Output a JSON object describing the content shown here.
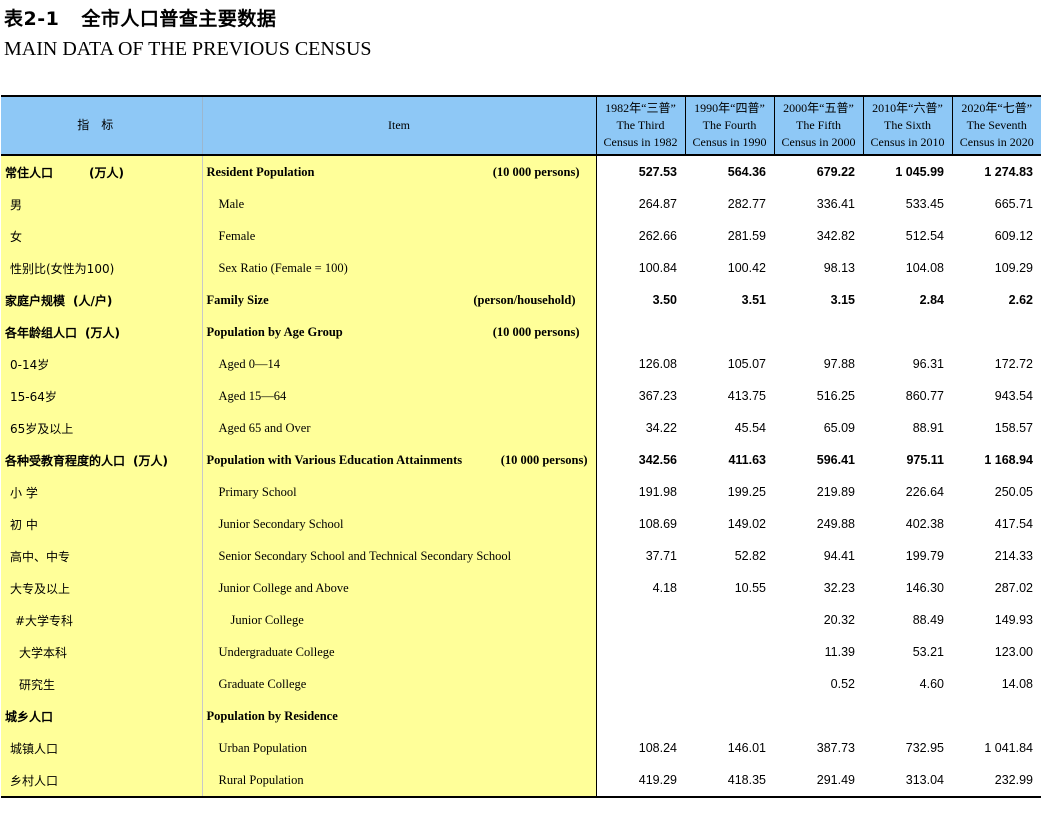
{
  "title": {
    "number": "表2-1",
    "cn": "全市人口普查主要数据",
    "en": "MAIN DATA OF THE PREVIOUS CENSUS"
  },
  "header": {
    "indicator": "指标",
    "item": "Item",
    "censuses": [
      {
        "cn": "1982年“三普”",
        "en1": "The Third",
        "en2": "Census in 1982"
      },
      {
        "cn": "1990年“四普”",
        "en1": "The Fourth",
        "en2": "Census in 1990"
      },
      {
        "cn": "2000年“五普”",
        "en1": "The Fifth",
        "en2": "Census in 2000"
      },
      {
        "cn": "2010年“六普”",
        "en1": "The Sixth",
        "en2": "Census in 2010"
      },
      {
        "cn": "2020年“七普”",
        "en1": "The Seventh",
        "en2": "Census in 2020"
      }
    ]
  },
  "rows": [
    {
      "name": "常住人口",
      "unit": "(万人)",
      "item": "Resident Population",
      "item_unit": "(10 000 persons)",
      "values": [
        "527.53",
        "564.36",
        "679.22",
        "1 045.99",
        "1 274.83"
      ],
      "bold": true,
      "level": 0
    },
    {
      "name": "男",
      "unit": "",
      "item": "Male",
      "item_unit": "",
      "values": [
        "264.87",
        "282.77",
        "336.41",
        "533.45",
        "665.71"
      ],
      "bold": false,
      "level": 1
    },
    {
      "name": "女",
      "unit": "",
      "item": "Female",
      "item_unit": "",
      "values": [
        "262.66",
        "281.59",
        "342.82",
        "512.54",
        "609.12"
      ],
      "bold": false,
      "level": 1
    },
    {
      "name": "性别比(女性为100)",
      "unit": "",
      "item": "Sex Ratio  (Female = 100)",
      "item_unit": "",
      "values": [
        "100.84",
        "100.42",
        "98.13",
        "104.08",
        "109.29"
      ],
      "bold": false,
      "level": 1
    },
    {
      "name": "家庭户规模",
      "unit": "(人/户)",
      "item": "Family Size",
      "item_unit": "(person/household)",
      "values": [
        "3.50",
        "3.51",
        "3.15",
        "2.84",
        "2.62"
      ],
      "bold": true,
      "level": 0
    },
    {
      "name": "各年龄组人口",
      "unit": "(万人)",
      "item": "Population by Age Group",
      "item_unit": "(10 000 persons)",
      "values": [
        "",
        "",
        "",
        "",
        ""
      ],
      "bold": true,
      "level": 0
    },
    {
      "name": "0-14岁",
      "unit": "",
      "item": "Aged 0—14",
      "item_unit": "",
      "values": [
        "126.08",
        "105.07",
        "97.88",
        "96.31",
        "172.72"
      ],
      "bold": false,
      "level": 1
    },
    {
      "name": "15-64岁",
      "unit": "",
      "item": "Aged 15—64",
      "item_unit": "",
      "values": [
        "367.23",
        "413.75",
        "516.25",
        "860.77",
        "943.54"
      ],
      "bold": false,
      "level": 1
    },
    {
      "name": "65岁及以上",
      "unit": "",
      "item": "Aged 65 and Over",
      "item_unit": "",
      "values": [
        "34.22",
        "45.54",
        "65.09",
        "88.91",
        "158.57"
      ],
      "bold": false,
      "level": 1
    },
    {
      "name": "各种受教育程度的人口",
      "unit": "(万人)",
      "item": "Population with Various Education Attainments",
      "item_unit": "(10 000 persons)",
      "values": [
        "342.56",
        "411.63",
        "596.41",
        "975.11",
        "1 168.94"
      ],
      "bold": true,
      "level": 0
    },
    {
      "name": "小  学",
      "unit": "",
      "item": "Primary School",
      "item_unit": "",
      "values": [
        "191.98",
        "199.25",
        "219.89",
        "226.64",
        "250.05"
      ],
      "bold": false,
      "level": 1
    },
    {
      "name": "初  中",
      "unit": "",
      "item": "Junior Secondary School",
      "item_unit": "",
      "values": [
        "108.69",
        "149.02",
        "249.88",
        "402.38",
        "417.54"
      ],
      "bold": false,
      "level": 1
    },
    {
      "name": "高中、中专",
      "unit": "",
      "item": "Senior Secondary School and Technical Secondary School",
      "item_unit": "",
      "values": [
        "37.71",
        "52.82",
        "94.41",
        "199.79",
        "214.33"
      ],
      "bold": false,
      "level": 1
    },
    {
      "name": "大专及以上",
      "unit": "",
      "item": "Junior College and Above",
      "item_unit": "",
      "values": [
        "4.18",
        "10.55",
        "32.23",
        "146.30",
        "287.02"
      ],
      "bold": false,
      "level": 1
    },
    {
      "name": "#大学专科",
      "unit": "",
      "item": "Junior College",
      "item_unit": "",
      "values": [
        "",
        "",
        "20.32",
        "88.49",
        "149.93"
      ],
      "bold": false,
      "level": 2
    },
    {
      "name": "大学本科",
      "unit": "",
      "item": "Undergraduate College",
      "item_unit": "",
      "values": [
        "",
        "",
        "11.39",
        "53.21",
        "123.00"
      ],
      "bold": false,
      "level": 3
    },
    {
      "name": "研究生",
      "unit": "",
      "item": "Graduate College",
      "item_unit": "",
      "values": [
        "",
        "",
        "0.52",
        "4.60",
        "14.08"
      ],
      "bold": false,
      "level": 3
    },
    {
      "name": "城乡人口",
      "unit": "",
      "item": "Population by Residence",
      "item_unit": "",
      "values": [
        "",
        "",
        "",
        "",
        ""
      ],
      "bold": true,
      "level": 0
    },
    {
      "name": "城镇人口",
      "unit": "",
      "item": "Urban Population",
      "item_unit": "",
      "values": [
        "108.24",
        "146.01",
        "387.73",
        "732.95",
        "1 041.84"
      ],
      "bold": false,
      "level": 1
    },
    {
      "name": "乡村人口",
      "unit": "",
      "item": "Rural Population",
      "item_unit": "",
      "values": [
        "419.29",
        "418.35",
        "291.49",
        "313.04",
        "232.99"
      ],
      "bold": false,
      "level": 1
    }
  ]
}
